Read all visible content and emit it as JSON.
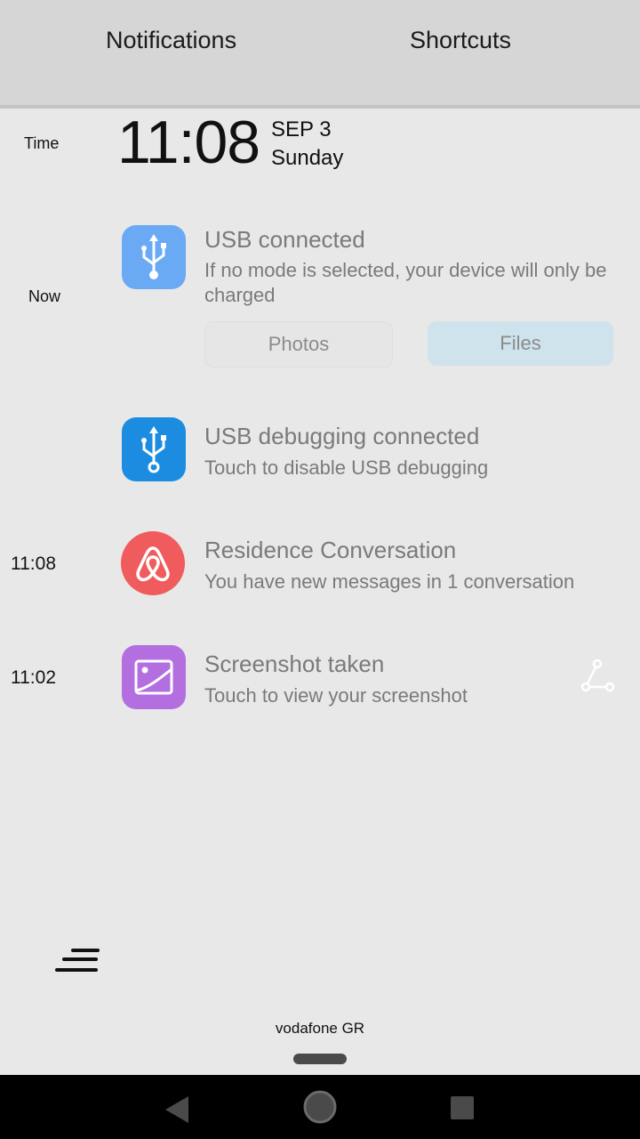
{
  "tabs": {
    "notifications": "Notifications",
    "shortcuts": "Shortcuts"
  },
  "clock": {
    "label": "Time",
    "time": "11:08",
    "date": "SEP 3",
    "day": "Sunday"
  },
  "notifications": [
    {
      "time_label": "Now",
      "title": "USB connected",
      "text": "If no mode is selected, your device will only be charged",
      "icon": "usb-icon",
      "buttons": [
        "Photos",
        "Files"
      ]
    },
    {
      "time_label": "",
      "title": "USB debugging connected",
      "text": "Touch to disable USB debugging",
      "icon": "usb-debug-icon"
    },
    {
      "time_label": "11:08",
      "title": "Residence Conversation",
      "text": "You have new messages in 1 conversation",
      "icon": "airbnb-icon"
    },
    {
      "time_label": "11:02",
      "title": "Screenshot taken",
      "text": "Touch to view your screenshot",
      "icon": "screenshot-icon",
      "action_icon": "share-icon"
    }
  ],
  "footer": {
    "carrier": "vodafone GR",
    "menu_icon": "menu-lines-icon"
  },
  "navbar": {
    "back": "back-icon",
    "home": "home-icon",
    "recents": "recents-icon"
  },
  "colors": {
    "usb_blue": "#6aa9f4",
    "usb_debug_blue": "#1c8ce0",
    "airbnb_red": "#f05c5d",
    "screenshot_purple": "#b36fe0",
    "files_button_bg": "#cfe3ec"
  }
}
